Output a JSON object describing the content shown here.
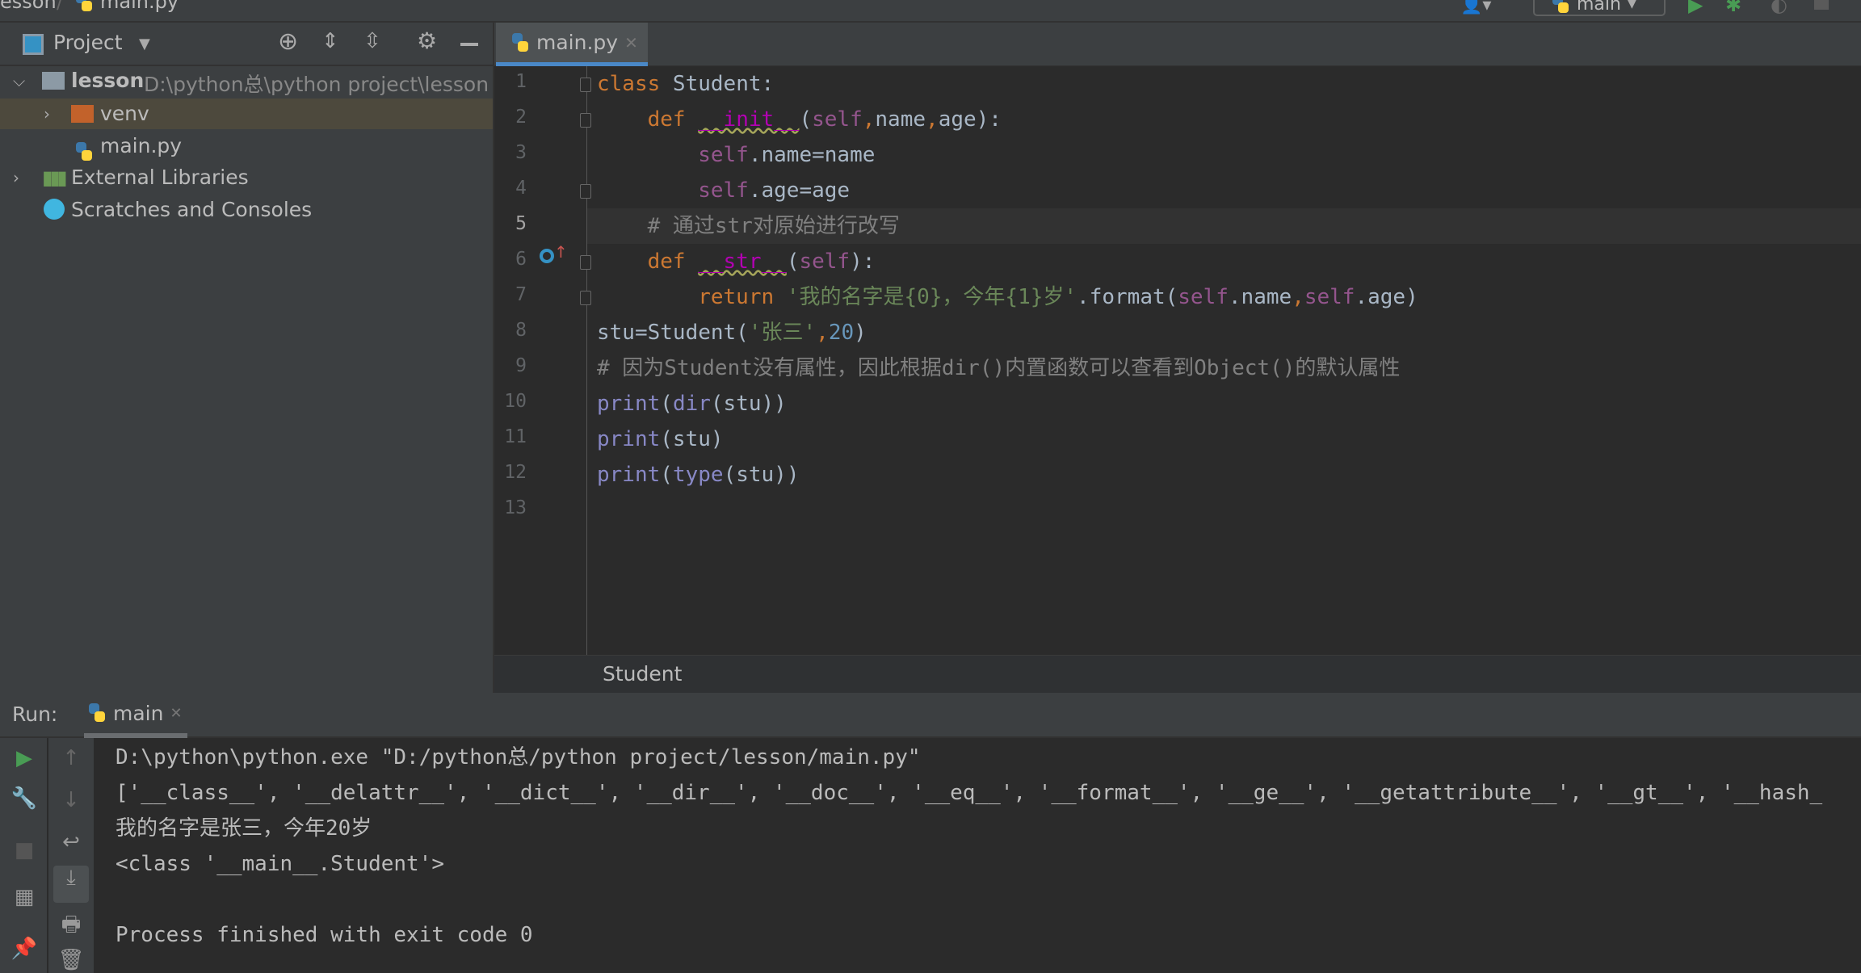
{
  "topbar": {
    "breadcrumb_project": "esson",
    "breadcrumb_sep": "/",
    "breadcrumb_file": "main.py",
    "run_config": "main"
  },
  "project_panel": {
    "title": "Project",
    "tree": [
      {
        "label": "lesson",
        "path": "D:\\python总\\python project\\lesson",
        "icon": "folder-icon"
      },
      {
        "label": "venv",
        "icon": "folder-orange-icon"
      },
      {
        "label": "main.py",
        "icon": "python-file-icon"
      },
      {
        "label": "External Libraries",
        "icon": "library-icon"
      },
      {
        "label": "Scratches and Consoles",
        "icon": "scratches-icon"
      }
    ]
  },
  "editor": {
    "tab": "main.py",
    "current_line": 5,
    "breadcrumb": "Student",
    "line_numbers": [
      "1",
      "2",
      "3",
      "4",
      "5",
      "6",
      "7",
      "8",
      "9",
      "10",
      "11",
      "12",
      "13"
    ],
    "lines": [
      [
        {
          "t": "class ",
          "c": "kw"
        },
        {
          "t": "Student:",
          "c": "tx"
        }
      ],
      [
        {
          "t": "    def ",
          "c": "kw"
        },
        {
          "t": "__init__",
          "c": "mg"
        },
        {
          "t": "(",
          "c": "tx"
        },
        {
          "t": "self",
          "c": "sf"
        },
        {
          "t": ",",
          "c": "kw"
        },
        {
          "t": "name",
          "c": "tx"
        },
        {
          "t": ",",
          "c": "kw"
        },
        {
          "t": "age):",
          "c": "tx"
        }
      ],
      [
        {
          "t": "        self",
          "c": "sf"
        },
        {
          "t": ".name=name",
          "c": "tx"
        }
      ],
      [
        {
          "t": "        self",
          "c": "sf"
        },
        {
          "t": ".age=age",
          "c": "tx"
        }
      ],
      [
        {
          "t": "    # 通过str对原始进行改写",
          "c": "cm"
        }
      ],
      [
        {
          "t": "    def ",
          "c": "kw"
        },
        {
          "t": "__str__",
          "c": "mg"
        },
        {
          "t": "(",
          "c": "tx"
        },
        {
          "t": "self",
          "c": "sf"
        },
        {
          "t": "):",
          "c": "tx"
        }
      ],
      [
        {
          "t": "        return ",
          "c": "kw"
        },
        {
          "t": "'我的名字是{0}，今年{1}岁'",
          "c": "st"
        },
        {
          "t": ".format(",
          "c": "tx"
        },
        {
          "t": "self",
          "c": "sf"
        },
        {
          "t": ".name",
          "c": "tx"
        },
        {
          "t": ",",
          "c": "kw"
        },
        {
          "t": "self",
          "c": "sf"
        },
        {
          "t": ".age)",
          "c": "tx"
        }
      ],
      [
        {
          "t": "stu=Student(",
          "c": "tx"
        },
        {
          "t": "'张三'",
          "c": "st"
        },
        {
          "t": ",",
          "c": "kw"
        },
        {
          "t": "20",
          "c": "nm"
        },
        {
          "t": ")",
          "c": "tx"
        }
      ],
      [
        {
          "t": "# 因为Student没有属性，因此根据dir()内置函数可以查看到Object()的默认属性",
          "c": "cm"
        }
      ],
      [
        {
          "t": "print",
          "c": "bi"
        },
        {
          "t": "(",
          "c": "tx"
        },
        {
          "t": "dir",
          "c": "bi"
        },
        {
          "t": "(stu))",
          "c": "tx"
        }
      ],
      [
        {
          "t": "print",
          "c": "bi"
        },
        {
          "t": "(stu)",
          "c": "tx"
        }
      ],
      [
        {
          "t": "print",
          "c": "bi"
        },
        {
          "t": "(",
          "c": "tx"
        },
        {
          "t": "type",
          "c": "bi"
        },
        {
          "t": "(stu))",
          "c": "tx"
        }
      ],
      []
    ]
  },
  "run": {
    "label": "Run:",
    "tab": "main",
    "output": [
      "D:\\python\\python.exe \"D:/python总/python project/lesson/main.py\"",
      "['__class__', '__delattr__', '__dict__', '__dir__', '__doc__', '__eq__', '__format__', '__ge__', '__getattribute__', '__gt__', '__hash_",
      "我的名字是张三，今年20岁",
      "<class '__main__.Student'>",
      "",
      "Process finished with exit code 0"
    ]
  },
  "colors": {
    "kw": "#cc7832",
    "tx": "#a9b7c6",
    "mg": "#b200b2",
    "sf": "#94558d",
    "st": "#6a8759",
    "nm": "#6897bb",
    "cm": "#808080",
    "bi": "#8888c6",
    "accent": "#4a88c7"
  }
}
